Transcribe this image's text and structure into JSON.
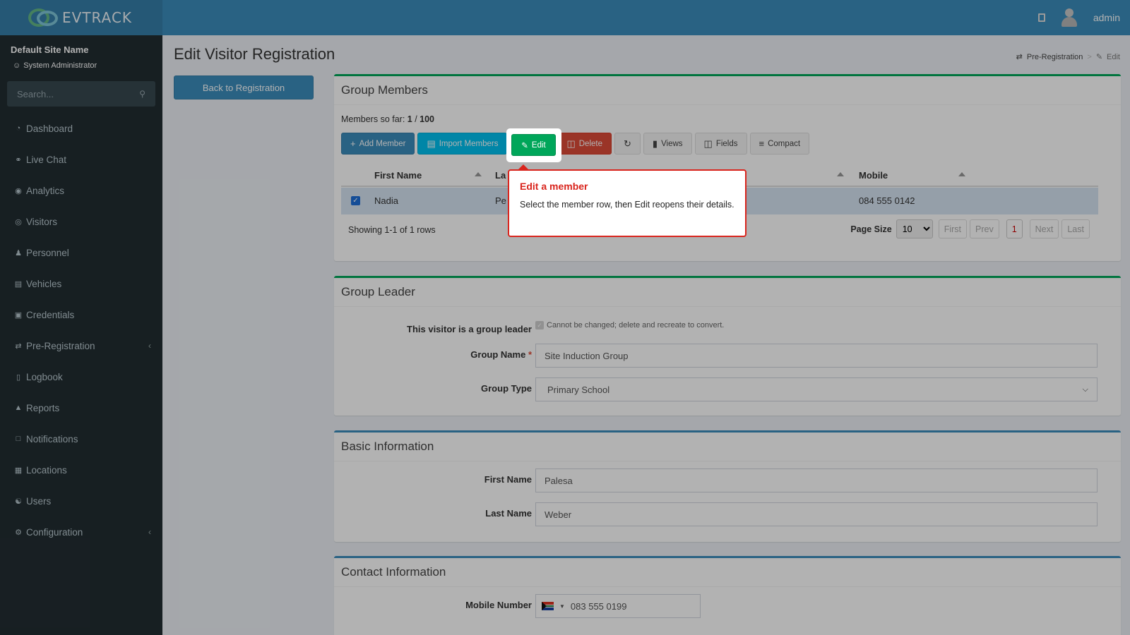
{
  "header": {
    "logo": "EVTRACK",
    "user": "admin"
  },
  "sidebar": {
    "site_name": "Default Site Name",
    "role": "System Administrator",
    "search_placeholder": "Search...",
    "items": [
      {
        "label": "Dashboard",
        "icon": "dashboard-icon"
      },
      {
        "label": "Live Chat",
        "icon": "headset-icon"
      },
      {
        "label": "Analytics",
        "icon": "target-icon"
      },
      {
        "label": "Visitors",
        "icon": "eye-icon"
      },
      {
        "label": "Personnel",
        "icon": "people-icon"
      },
      {
        "label": "Vehicles",
        "icon": "car-icon"
      },
      {
        "label": "Credentials",
        "icon": "id-card-icon"
      },
      {
        "label": "Pre-Registration",
        "icon": "exchange-icon"
      },
      {
        "label": "Logbook",
        "icon": "book-icon"
      },
      {
        "label": "Reports",
        "icon": "chart-icon"
      },
      {
        "label": "Notifications",
        "icon": "message-icon"
      },
      {
        "label": "Locations",
        "icon": "map-icon"
      },
      {
        "label": "Users",
        "icon": "user-cog-icon"
      },
      {
        "label": "Configuration",
        "icon": "gear-icon"
      }
    ]
  },
  "page": {
    "title": "Edit Visitor Registration",
    "breadcrumb": [
      "Pre-Registration",
      "Edit"
    ],
    "back_button": "Back to Registration"
  },
  "members": {
    "title": "Group Members",
    "count_prefix": "Members so far: ",
    "count_current": "1",
    "count_sep": " / ",
    "count_max": "100",
    "toolbar": {
      "add": "Add Member",
      "import": "Import Members",
      "edit": "Edit",
      "delete": "Delete",
      "views": "Views",
      "fields": "Fields",
      "compact": "Compact"
    },
    "columns": [
      "First Name",
      "La",
      "Mobile"
    ],
    "rows": [
      {
        "first_name": "Nadia",
        "last_name": "Pe",
        "mobile": "084 555 0142"
      }
    ],
    "showing": "Showing 1-1 of 1 rows",
    "pager": {
      "page_size_label": "Page Size",
      "page_size": "10",
      "first": "First",
      "prev": "Prev",
      "current": "1",
      "next": "Next",
      "last": "Last"
    }
  },
  "leader": {
    "title": "Group Leader",
    "is_leader_label": "This visitor is a group leader",
    "is_leader_note": "Cannot be changed; delete and recreate to convert.",
    "group_name_label": "Group Name",
    "required_mark": "*",
    "group_name": "Site Induction Group",
    "group_type_label": "Group Type",
    "group_type": "Primary School"
  },
  "basic": {
    "title": "Basic Information",
    "first_name_label": "First Name",
    "first_name": "Palesa",
    "last_name_label": "Last Name",
    "last_name": "Weber"
  },
  "contact": {
    "title": "Contact Information",
    "mobile_label": "Mobile Number",
    "mobile": "083 555 0199"
  },
  "tooltip": {
    "title": "Edit a member",
    "body": "Select the member row, then Edit reopens their details."
  }
}
